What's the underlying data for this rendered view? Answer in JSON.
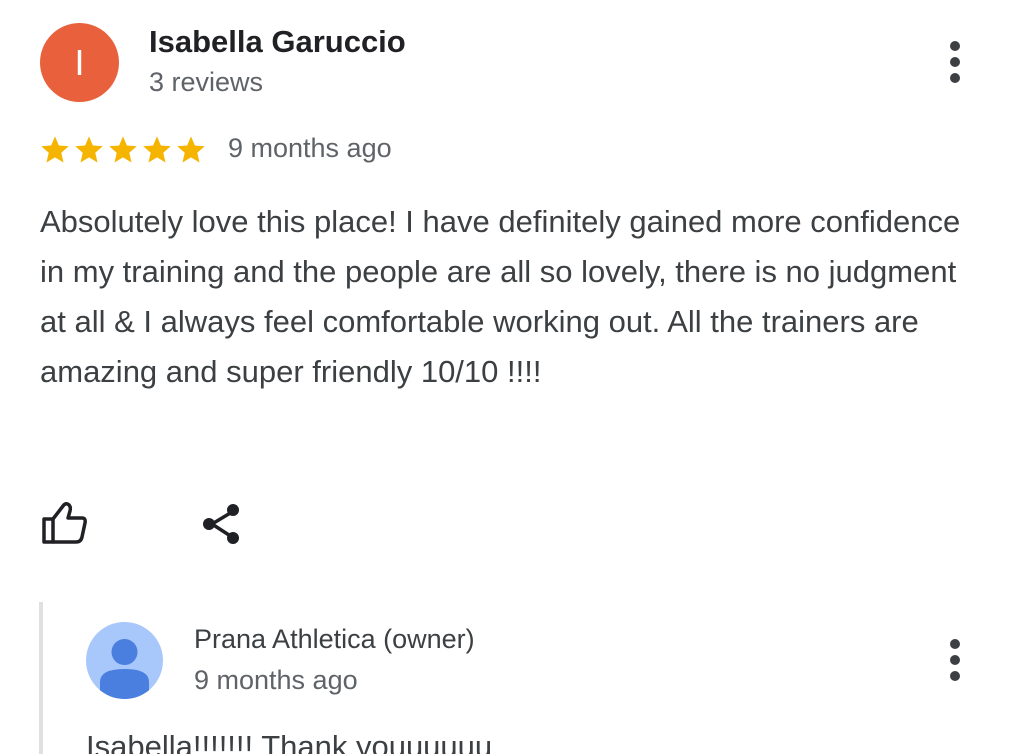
{
  "review": {
    "avatar_letter": "I",
    "avatar_color": "#e8613c",
    "author_name": "Isabella Garuccio",
    "review_count": "3 reviews",
    "rating": 5,
    "rating_max": 5,
    "star_color": "#f4b400",
    "date": "9 months ago",
    "text": "Absolutely love this place! I have definitely gained more confidence in my training and the people are all so lovely, there is no judgment at all & I always feel comfortable working out. All the trainers are amazing and super friendly 10/10 !!!!",
    "actions": {
      "like_icon": "thumbs-up-icon",
      "share_icon": "share-icon",
      "more_icon": "more-vertical-icon"
    }
  },
  "owner_response": {
    "avatar_icon": "person-icon",
    "avatar_color": "#a8c7fa",
    "name": "Prana Athletica (owner)",
    "date": "9 months ago",
    "text": "Isabella!!!!!!! Thank youuuuuu"
  }
}
